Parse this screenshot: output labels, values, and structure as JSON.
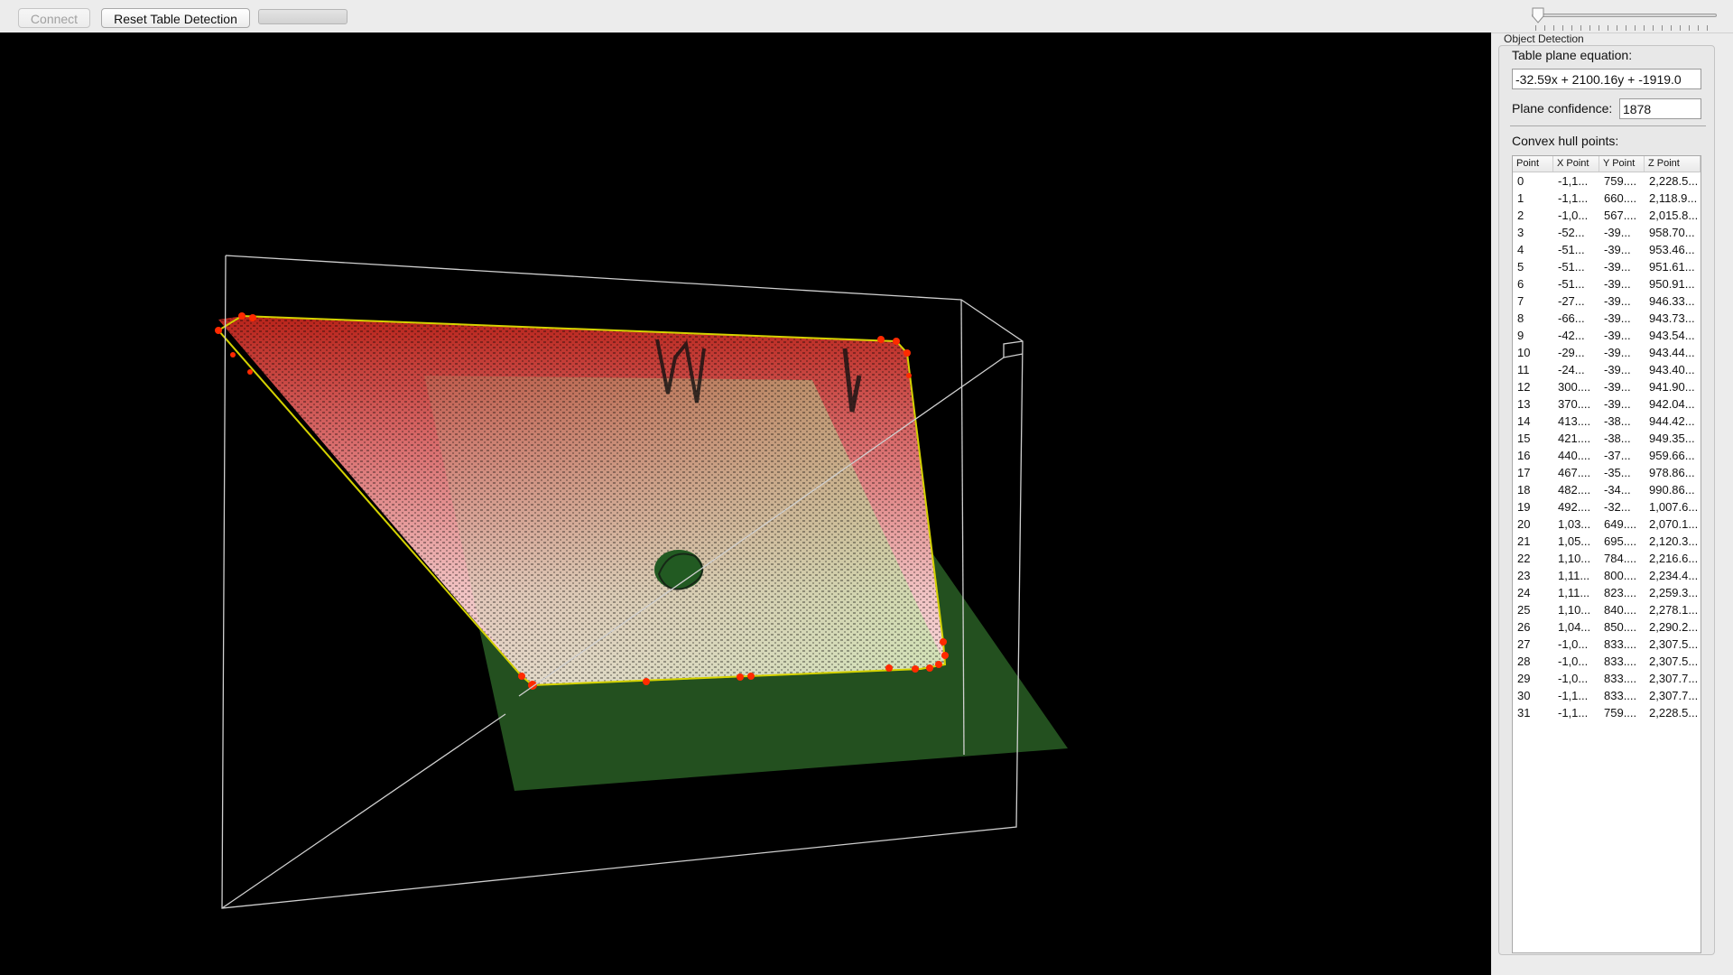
{
  "toolbar": {
    "connect_label": "Connect",
    "reset_label": "Reset Table Detection",
    "progress_value": 0
  },
  "object_detection": {
    "label": "Object Detection",
    "slider_value": 0
  },
  "panel": {
    "plane_equation_label": "Table plane equation:",
    "plane_equation_value": "-32.59x + 2100.16y + -1919.0",
    "plane_confidence_label": "Plane confidence:",
    "plane_confidence_value": "1878",
    "hull_points_label": "Convex hull points:",
    "table": {
      "headers": [
        "Point",
        "X Point",
        "Y Point",
        "Z Point"
      ],
      "rows": [
        [
          "0",
          "-1,1...",
          "759....",
          "2,228.5..."
        ],
        [
          "1",
          "-1,1...",
          "660....",
          "2,118.9..."
        ],
        [
          "2",
          "-1,0...",
          "567....",
          "2,015.8..."
        ],
        [
          "3",
          "-52...",
          "-39...",
          "958.70..."
        ],
        [
          "4",
          "-51...",
          "-39...",
          "953.46..."
        ],
        [
          "5",
          "-51...",
          "-39...",
          "951.61..."
        ],
        [
          "6",
          "-51...",
          "-39...",
          "950.91..."
        ],
        [
          "7",
          "-27...",
          "-39...",
          "946.33..."
        ],
        [
          "8",
          "-66...",
          "-39...",
          "943.73..."
        ],
        [
          "9",
          "-42...",
          "-39...",
          "943.54..."
        ],
        [
          "10",
          "-29...",
          "-39...",
          "943.44..."
        ],
        [
          "11",
          "-24...",
          "-39...",
          "943.40..."
        ],
        [
          "12",
          "300....",
          "-39...",
          "941.90..."
        ],
        [
          "13",
          "370....",
          "-39...",
          "942.04..."
        ],
        [
          "14",
          "413....",
          "-38...",
          "944.42..."
        ],
        [
          "15",
          "421....",
          "-38...",
          "949.35..."
        ],
        [
          "16",
          "440....",
          "-37...",
          "959.66..."
        ],
        [
          "17",
          "467....",
          "-35...",
          "978.86..."
        ],
        [
          "18",
          "482....",
          "-34...",
          "990.86..."
        ],
        [
          "19",
          "492....",
          "-32...",
          "1,007.6..."
        ],
        [
          "20",
          "1,03...",
          "649....",
          "2,070.1..."
        ],
        [
          "21",
          "1,05...",
          "695....",
          "2,120.3..."
        ],
        [
          "22",
          "1,10...",
          "784....",
          "2,216.6..."
        ],
        [
          "23",
          "1,11...",
          "800....",
          "2,234.4..."
        ],
        [
          "24",
          "1,11...",
          "823....",
          "2,259.3..."
        ],
        [
          "25",
          "1,10...",
          "840....",
          "2,278.1..."
        ],
        [
          "26",
          "1,04...",
          "850....",
          "2,290.2..."
        ],
        [
          "27",
          "-1,0...",
          "833....",
          "2,307.5..."
        ],
        [
          "28",
          "-1,0...",
          "833....",
          "2,307.5..."
        ],
        [
          "29",
          "-1,0...",
          "833....",
          "2,307.7..."
        ],
        [
          "30",
          "-1,1...",
          "833....",
          "2,307.7..."
        ],
        [
          "31",
          "-1,1...",
          "759....",
          "2,228.5..."
        ]
      ]
    }
  },
  "colors": {
    "viewport_bg": "#000000",
    "plane_green": "#23501f",
    "hull_line": "#d4d200",
    "hull_points": "#ff2a00",
    "cloud_red": "#c8281e",
    "cloud_pink": "#f2c4c4",
    "bounding_box": "#cfcfcf"
  }
}
